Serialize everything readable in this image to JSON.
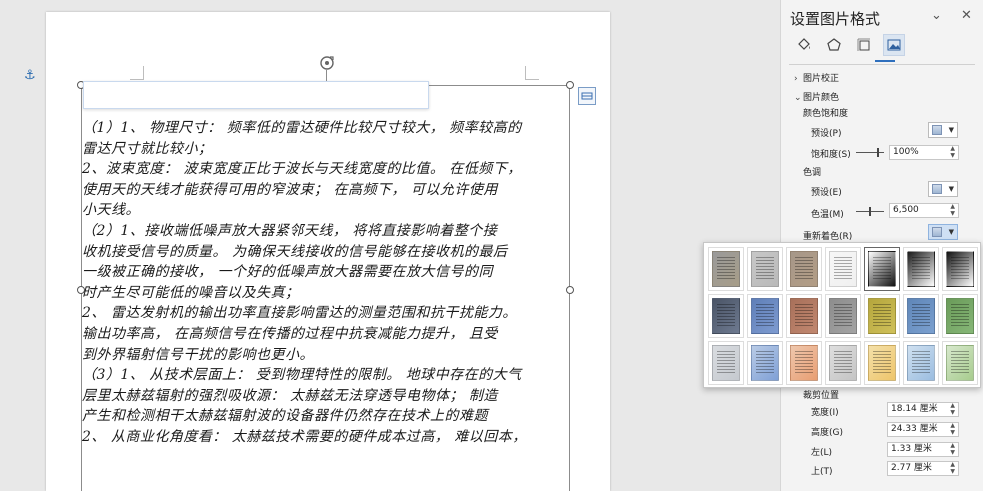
{
  "document": {
    "handwriting_lines": [
      "（1）1、 物理尺寸： 频率低的雷达硬件比较尺寸较大， 频率较高的",
      "雷达尺寸就比较小；",
      "2、波束宽度： 波束宽度正比于波长与天线宽度的比值。 在低频下，",
      "使用天的天线才能获得可用的窄波束； 在高频下， 可以允许使用",
      "小天线。",
      "（2）1、接收端低噪声放大器紧邻天线， 将将直接影响着整个接",
      "收机接受信号的质量。 为确保天线接收的信号能够在接收机的最后",
      "一级被正确的接收， 一个好的低噪声放大器需要在放大信号的同",
      "时产生尽可能低的噪音以及失真；",
      "2、 雷达发射机的输出功率直接影响雷达的测量范围和抗干扰能力。",
      "输出功率高， 在高频信号在传播的过程中抗衰减能力提升， 且受",
      "到外界辐射信号干扰的影响也更小。",
      "（3）1、 从技术层面上： 受到物理特性的限制。 地球中存在的大气",
      "层里太赫兹辐射的强烈吸收源： 太赫兹无法穿透导电物体； 制造",
      "产生和检测相干太赫兹辐射波的设备器件仍然存在技术上的难题",
      "2、 从商业化角度看： 太赫兹技术需要的硬件成本过高， 难以回本，"
    ]
  },
  "panel": {
    "title": "设置图片格式",
    "minimize_glyph": "⌄",
    "close_glyph": "✕",
    "tabs": [
      {
        "name": "fill-line",
        "icon": "paint-bucket-icon"
      },
      {
        "name": "effects",
        "icon": "pentagon-icon"
      },
      {
        "name": "layout-properties",
        "icon": "layout-size-icon"
      },
      {
        "name": "picture",
        "icon": "picture-icon",
        "active": true
      }
    ],
    "sections": {
      "correction": "图片校正",
      "color": "图片颜色"
    },
    "color_saturation": "颜色饱和度",
    "preset_label": "预设(P)",
    "saturation_label": "饱和度(S)",
    "saturation_value": "100%",
    "tone_label": "色调",
    "tone_preset_label": "预设(E)",
    "temperature_label": "色温(M)",
    "temperature_value": "6,500",
    "recolor_label": "重新着色(R)",
    "crop_position_label": "裁剪位置",
    "width_label": "宽度(I)",
    "width_value": "18.14 厘米",
    "height_label": "高度(G)",
    "height_value": "24.33 厘米",
    "left_label": "左(L)",
    "left_value": "1.33 厘米",
    "top_label": "上(T)",
    "top_value": "2.77 厘米"
  },
  "recolor_gallery": {
    "thumbs": [
      {
        "bg": "#9a9a9a",
        "tint": "#a79d88"
      },
      {
        "bg": "#c7c7c7",
        "tint": "#b9b9b9"
      },
      {
        "bg": "#a69789",
        "tint": "#b39d85"
      },
      {
        "bg": "#f6f6f6",
        "tint": "#f0f0f0"
      },
      {
        "bg": "#ffffff",
        "tint": "#111111",
        "selected": true
      },
      {
        "bg": "#1a1a1a",
        "tint": "#ffffff"
      },
      {
        "bg": "#111111",
        "tint": "#ffffff"
      },
      {
        "bg": "#4a5466",
        "tint": "#6e7a90"
      },
      {
        "bg": "#5f7fb8",
        "tint": "#7e9bd0"
      },
      {
        "bg": "#a8705a",
        "tint": "#c18870"
      },
      {
        "bg": "#8d8d8d",
        "tint": "#a3a3a3"
      },
      {
        "bg": "#b5a63c",
        "tint": "#cfc05a"
      },
      {
        "bg": "#5f86b8",
        "tint": "#7ba0cf"
      },
      {
        "bg": "#6a9b59",
        "tint": "#86b777"
      },
      {
        "bg": "#d9dce0",
        "tint": "#c5c9cf"
      },
      {
        "bg": "#b9cbe6",
        "tint": "#7fa0d6"
      },
      {
        "bg": "#efc7ad",
        "tint": "#e89e72"
      },
      {
        "bg": "#dedede",
        "tint": "#c4c4c4"
      },
      {
        "bg": "#f4e0a8",
        "tint": "#eec56b"
      },
      {
        "bg": "#cfe0f0",
        "tint": "#9bbde0"
      },
      {
        "bg": "#d7e8cc",
        "tint": "#a7cc8e"
      }
    ]
  }
}
